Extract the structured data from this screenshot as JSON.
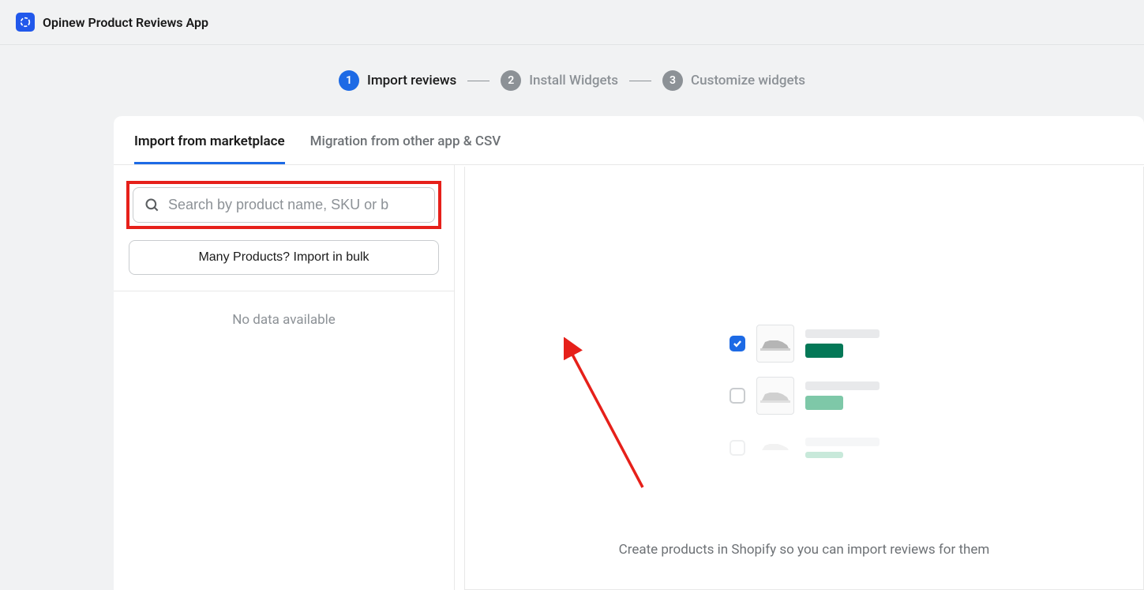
{
  "header": {
    "title": "Opinew Product Reviews App"
  },
  "stepper": {
    "steps": [
      {
        "number": "1",
        "label": "Import reviews",
        "active": true
      },
      {
        "number": "2",
        "label": "Install Widgets",
        "active": false
      },
      {
        "number": "3",
        "label": "Customize widgets",
        "active": false
      }
    ]
  },
  "tabs": [
    {
      "label": "Import from marketplace",
      "active": true
    },
    {
      "label": "Migration from other app & CSV",
      "active": false
    }
  ],
  "search": {
    "placeholder": "Search by product name, SKU or b"
  },
  "bulk_button": "Many Products? Import in bulk",
  "no_data": "No data available",
  "empty_state": {
    "message": "Create products in Shopify so you can import reviews for them"
  }
}
